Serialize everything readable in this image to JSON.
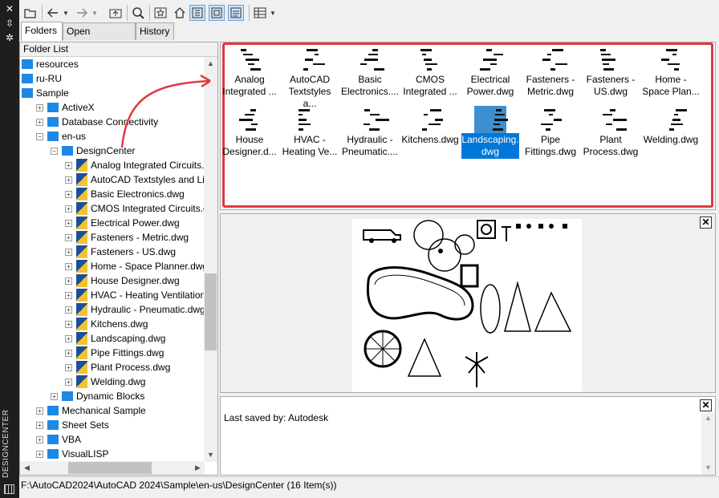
{
  "palette": {
    "title": "DESIGNCENTER",
    "accent": "#0078d7",
    "highlight": "#e0393e",
    "folder_color": "#1e88e5"
  },
  "toolbar": {
    "buttons": [
      {
        "icon": "load-icon"
      },
      {
        "icon": "back-icon"
      },
      {
        "icon": "forward-icon"
      },
      {
        "icon": "up-icon"
      },
      {
        "icon": "search-icon"
      },
      {
        "icon": "favorites-icon"
      },
      {
        "icon": "home-icon"
      },
      {
        "icon": "tree-view-toggle-icon"
      },
      {
        "icon": "preview-toggle-icon"
      },
      {
        "icon": "description-toggle-icon"
      },
      {
        "icon": "views-icon"
      }
    ]
  },
  "tabs": [
    {
      "label": "Folders"
    },
    {
      "label": "Open Drawings"
    },
    {
      "label": "History"
    }
  ],
  "folder_list": {
    "header": "Folder List",
    "items": [
      {
        "label": "resources",
        "kind": "folder"
      },
      {
        "label": "ru-RU",
        "kind": "folder"
      },
      {
        "label": "Sample",
        "kind": "folder"
      },
      {
        "label": "ActiveX",
        "kind": "folder",
        "exp": "+"
      },
      {
        "label": "Database Connectivity",
        "kind": "folder",
        "exp": "+"
      },
      {
        "label": "en-us",
        "kind": "folder",
        "exp": "−"
      },
      {
        "label": "DesignCenter",
        "kind": "folder",
        "exp": "−"
      },
      {
        "label": "Analog Integrated Circuits.dwg",
        "kind": "dwg",
        "exp": "+"
      },
      {
        "label": "AutoCAD Textstyles and Linetypes.dwg",
        "kind": "dwg",
        "exp": "+"
      },
      {
        "label": "Basic Electronics.dwg",
        "kind": "dwg",
        "exp": "+"
      },
      {
        "label": "CMOS Integrated Circuits.dwg",
        "kind": "dwg",
        "exp": "+"
      },
      {
        "label": "Electrical Power.dwg",
        "kind": "dwg",
        "exp": "+"
      },
      {
        "label": "Fasteners - Metric.dwg",
        "kind": "dwg",
        "exp": "+"
      },
      {
        "label": "Fasteners - US.dwg",
        "kind": "dwg",
        "exp": "+"
      },
      {
        "label": "Home - Space Planner.dwg",
        "kind": "dwg",
        "exp": "+"
      },
      {
        "label": "House Designer.dwg",
        "kind": "dwg",
        "exp": "+"
      },
      {
        "label": "HVAC - Heating Ventilation Air Conditioning.dwg",
        "kind": "dwg",
        "exp": "+"
      },
      {
        "label": "Hydraulic - Pneumatic.dwg",
        "kind": "dwg",
        "exp": "+"
      },
      {
        "label": "Kitchens.dwg",
        "kind": "dwg",
        "exp": "+"
      },
      {
        "label": "Landscaping.dwg",
        "kind": "dwg",
        "exp": "+"
      },
      {
        "label": "Pipe Fittings.dwg",
        "kind": "dwg",
        "exp": "+"
      },
      {
        "label": "Plant Process.dwg",
        "kind": "dwg",
        "exp": "+"
      },
      {
        "label": "Welding.dwg",
        "kind": "dwg",
        "exp": "+"
      },
      {
        "label": "Dynamic Blocks",
        "kind": "folder",
        "exp": "+"
      },
      {
        "label": "Mechanical Sample",
        "kind": "folder",
        "exp": "+"
      },
      {
        "label": "Sheet Sets",
        "kind": "folder",
        "exp": "+"
      },
      {
        "label": "VBA",
        "kind": "folder",
        "exp": "+"
      },
      {
        "label": "VisualLISP",
        "kind": "folder",
        "exp": "+"
      }
    ]
  },
  "content": {
    "items": [
      {
        "label": "Analog\nIntegrated ..."
      },
      {
        "label": "AutoCAD\nTextstyles a..."
      },
      {
        "label": "Basic\nElectronics...."
      },
      {
        "label": "CMOS\nIntegrated ..."
      },
      {
        "label": "Electrical\nPower.dwg"
      },
      {
        "label": "Fasteners -\nMetric.dwg"
      },
      {
        "label": "Fasteners -\nUS.dwg"
      },
      {
        "label": "Home -\nSpace Plan..."
      },
      {
        "label": "House\nDesigner.d..."
      },
      {
        "label": "HVAC -\nHeating Ve..."
      },
      {
        "label": "Hydraulic -\nPneumatic...."
      },
      {
        "label": "Kitchens.dwg"
      },
      {
        "label": "Landscaping.\ndwg",
        "selected": true
      },
      {
        "label": "Pipe\nFittings.dwg"
      },
      {
        "label": "Plant\nProcess.dwg"
      },
      {
        "label": "Welding.dwg"
      }
    ]
  },
  "description": {
    "text": "Last saved by: Autodesk"
  },
  "status": {
    "path": "F:\\AutoCAD2024\\AutoCAD 2024\\Sample\\en-us\\DesignCenter (16 Item(s))"
  }
}
